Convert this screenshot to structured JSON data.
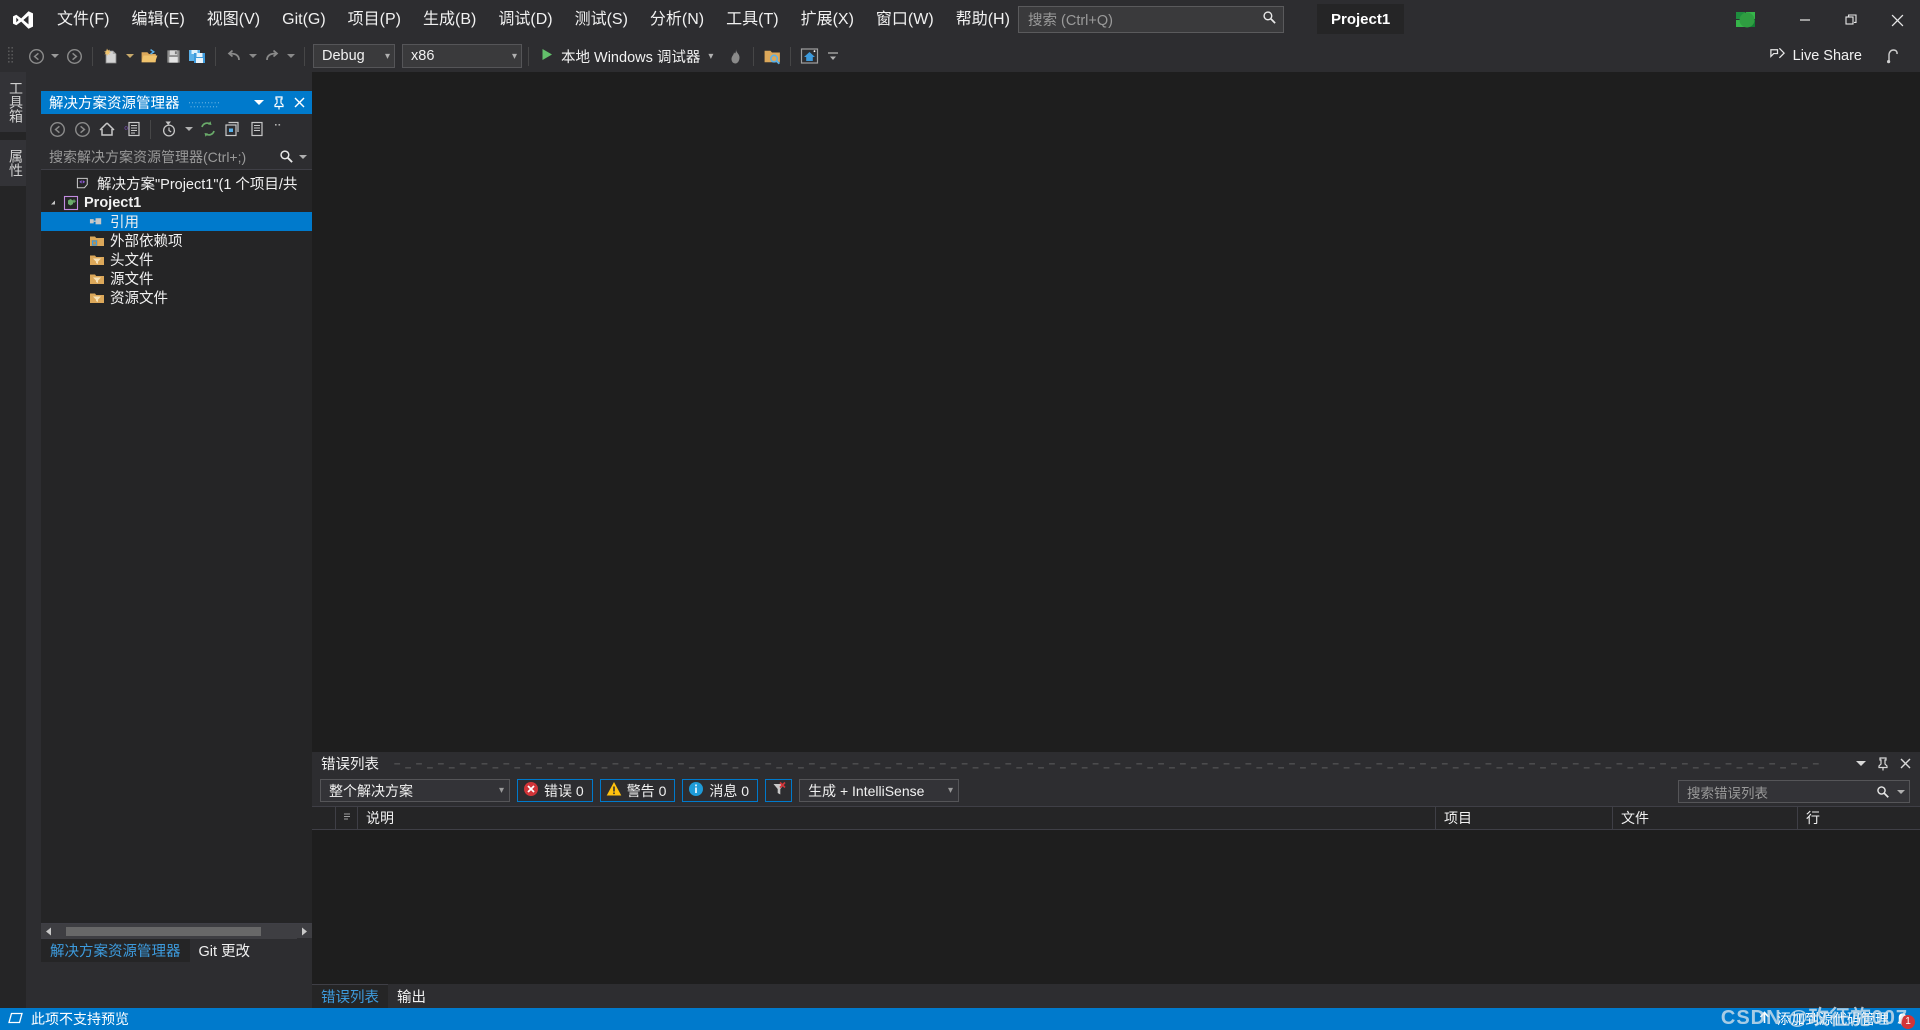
{
  "titlebar": {
    "logo": "vs-logo-icon",
    "menus": [
      {
        "label": "文件(F)"
      },
      {
        "label": "编辑(E)"
      },
      {
        "label": "视图(V)"
      },
      {
        "label": "Git(G)"
      },
      {
        "label": "项目(P)"
      },
      {
        "label": "生成(B)"
      },
      {
        "label": "调试(D)"
      },
      {
        "label": "测试(S)"
      },
      {
        "label": "分析(N)"
      },
      {
        "label": "工具(T)"
      },
      {
        "label": "扩展(X)"
      },
      {
        "label": "窗口(W)"
      },
      {
        "label": "帮助(H)"
      }
    ],
    "search": {
      "placeholder": "搜索 (Ctrl+Q)",
      "value": ""
    },
    "project_chip": "Project1",
    "window": {
      "minimize": "—",
      "restore": "❐",
      "close": "✕"
    }
  },
  "toolbar": {
    "config": {
      "label": "Debug",
      "caret": "▾"
    },
    "platform": {
      "label": "x86",
      "caret": "▾"
    },
    "run": {
      "label": "本地 Windows 调试器",
      "caret": "▾"
    },
    "live_share": "Live Share"
  },
  "vtabs": [
    {
      "label": "工具箱"
    },
    {
      "label": "属性"
    }
  ],
  "solution_explorer": {
    "title": "解决方案资源管理器",
    "search": {
      "placeholder": "搜索解决方案资源管理器(Ctrl+;)",
      "value": ""
    },
    "tree": [
      {
        "label": "解决方案\"Project1\"(1 个项目/共 ",
        "icon": "solution-icon",
        "indent": 0,
        "bold": false,
        "expander": "",
        "selected": false
      },
      {
        "label": "Project1",
        "icon": "cpp-project-icon",
        "indent": 1,
        "bold": true,
        "expander": "▴",
        "selected": false
      },
      {
        "label": "引用",
        "icon": "references-icon",
        "indent": 2,
        "bold": false,
        "expander": "",
        "selected": true
      },
      {
        "label": "外部依赖项",
        "icon": "external-deps-icon",
        "indent": 2,
        "bold": false,
        "expander": "",
        "selected": false
      },
      {
        "label": "头文件",
        "icon": "filter-folder-icon",
        "indent": 2,
        "bold": false,
        "expander": "",
        "selected": false
      },
      {
        "label": "源文件",
        "icon": "filter-folder-icon",
        "indent": 2,
        "bold": false,
        "expander": "",
        "selected": false
      },
      {
        "label": "资源文件",
        "icon": "filter-folder-icon",
        "indent": 2,
        "bold": false,
        "expander": "",
        "selected": false
      }
    ],
    "tabs": [
      {
        "label": "解决方案资源管理器",
        "active": true
      },
      {
        "label": "Git 更改",
        "active": false
      }
    ]
  },
  "error_list": {
    "title": "错误列表",
    "scope": {
      "label": "整个解决方案",
      "caret": "▾"
    },
    "errors": {
      "label": "错误 0",
      "icon": "error-icon"
    },
    "warnings": {
      "label": "警告 0",
      "icon": "warning-icon"
    },
    "messages": {
      "label": "消息 0",
      "icon": "info-icon"
    },
    "clear_filter": {
      "icon": "clear-filter-icon"
    },
    "build_filter": {
      "label": "生成 + IntelliSense",
      "caret": "▾"
    },
    "search": {
      "placeholder": "搜索错误列表",
      "value": ""
    },
    "columns": [
      {
        "label": "说明"
      },
      {
        "label": "项目"
      },
      {
        "label": "文件"
      },
      {
        "label": "行"
      }
    ],
    "rows": [],
    "tabs": [
      {
        "label": "错误列表",
        "active": true
      },
      {
        "label": "输出",
        "active": false
      }
    ]
  },
  "statusbar": {
    "message": "此项不支持预览",
    "source_control": "添加到源代码管理",
    "notification_count": "1",
    "watermark": "CSDN @玫征施007",
    "accent": "#007acc"
  },
  "colors": {
    "accent": "#007acc",
    "chrome": "#2d2d30",
    "panel": "#252526",
    "document": "#1e1e1e",
    "error": "#d13438",
    "warning": "#ffc20e",
    "info": "#1e9bd8"
  }
}
